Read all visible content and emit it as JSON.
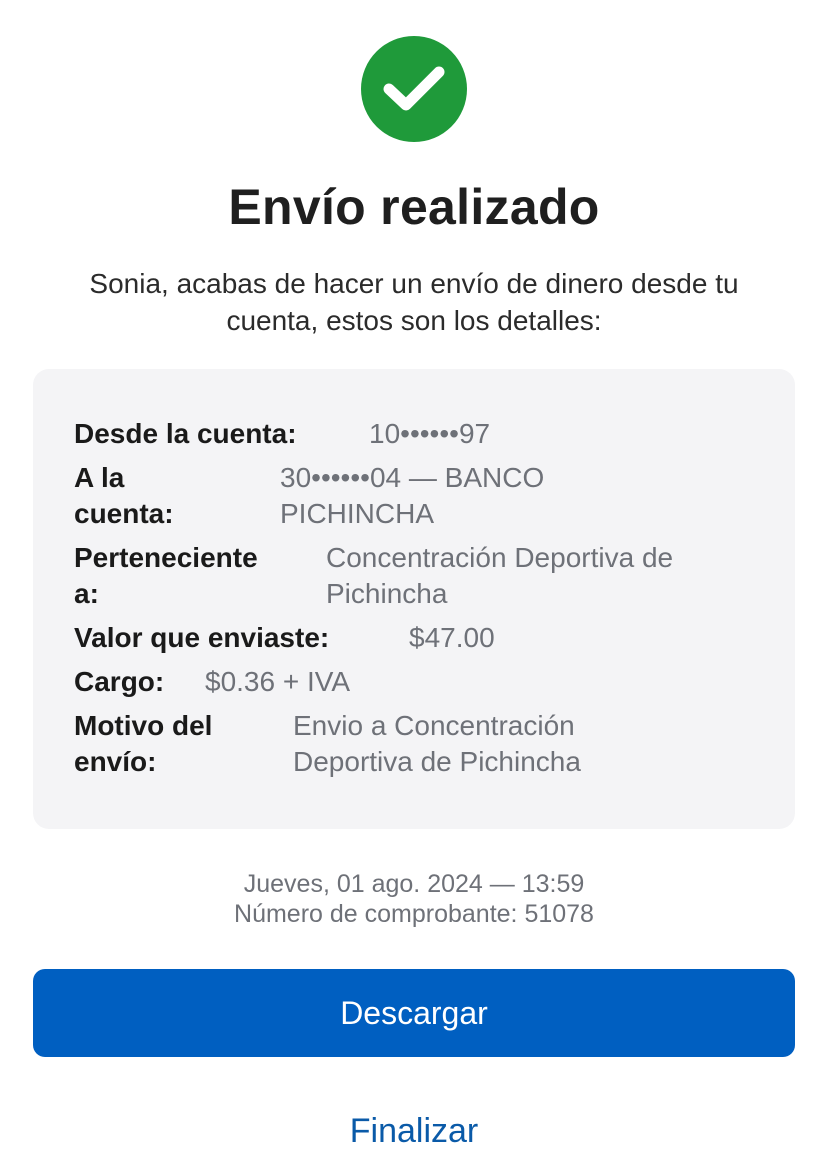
{
  "header": {
    "icon": "check-circle-icon",
    "title": "Envío realizado",
    "subtitle": "Sonia, acabas de hacer un envío de dinero desde tu cuenta, estos son los detalles:"
  },
  "details": {
    "from_account": {
      "label": "Desde la cuenta:",
      "value": "10••••••97"
    },
    "to_account": {
      "label_line1": "A la",
      "label_line2": "cuenta:",
      "value_line1": "30••••••04 — BANCO",
      "value_line2": "PICHINCHA"
    },
    "owner": {
      "label_line1": "Perteneciente",
      "label_line2": "a:",
      "value_line1": "Concentración Deportiva de",
      "value_line2": "Pichincha"
    },
    "amount": {
      "label": "Valor que enviaste:",
      "value": "$47.00"
    },
    "fee": {
      "label": "Cargo:",
      "value": "$0.36 + IVA"
    },
    "reason": {
      "label_line1": "Motivo del",
      "label_line2": "envío:",
      "value_line1": "Envio a Concentración",
      "value_line2": "Deportiva de Pichincha"
    }
  },
  "meta": {
    "datetime": "Jueves, 01 ago. 2024 — 13:59",
    "receipt": "Número de comprobante: 51078"
  },
  "actions": {
    "download_label": "Descargar",
    "finish_label": "Finalizar"
  },
  "colors": {
    "success": "#1f9a3a",
    "primary": "#005fc1",
    "link": "#0a5aa8",
    "card_bg": "#f4f4f6"
  }
}
